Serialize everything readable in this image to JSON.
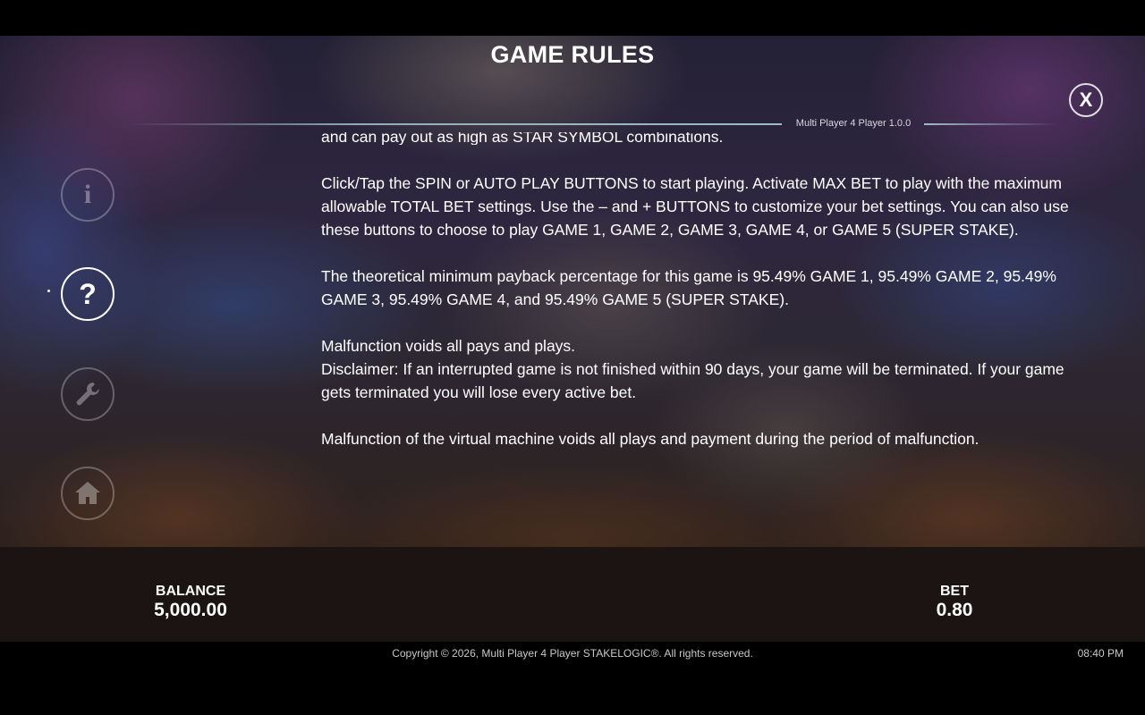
{
  "header": {
    "title": "GAME RULES",
    "version": "Multi Player 4 Player 1.0.0",
    "close_label": "X"
  },
  "sidebar": {
    "items": [
      {
        "icon": "info-icon",
        "glyph": "i",
        "active": false
      },
      {
        "icon": "help-icon",
        "glyph": "?",
        "active": true
      },
      {
        "icon": "wrench-icon",
        "glyph": "",
        "active": false
      },
      {
        "icon": "home-icon",
        "glyph": "",
        "active": false
      }
    ]
  },
  "rules": {
    "partial_line": "and can pay out as high as STAR SYMBOL combinations.",
    "paragraphs": [
      "Click/Tap the SPIN or AUTO PLAY BUTTONS to start playing. Activate MAX BET to play with the maximum allowable TOTAL BET settings. Use the – and + BUTTONS to customize your bet settings. You can also use these buttons to choose to play GAME 1, GAME 2, GAME 3, GAME 4, or GAME 5 (SUPER STAKE).",
      "The theoretical minimum payback percentage for this game is 95.49% GAME 1, 95.49% GAME 2, 95.49% GAME 3, 95.49% GAME 4, and 95.49% GAME 5 (SUPER STAKE).",
      "Malfunction voids all pays and plays.",
      "Disclaimer: If an interrupted game is not finished within 90 days, your game will be terminated. If your game gets terminated you will lose every active bet.",
      "Malfunction of the virtual machine voids all plays and payment during the period of malfunction."
    ]
  },
  "footer": {
    "balance_label": "BALANCE",
    "balance_value": "5,000.00",
    "bet_label": "BET",
    "bet_value": "0.80",
    "copyright": "Copyright © 2026, Multi Player 4 Player STAKELOGIC®. All rights reserved.",
    "time": "08:40 PM"
  }
}
